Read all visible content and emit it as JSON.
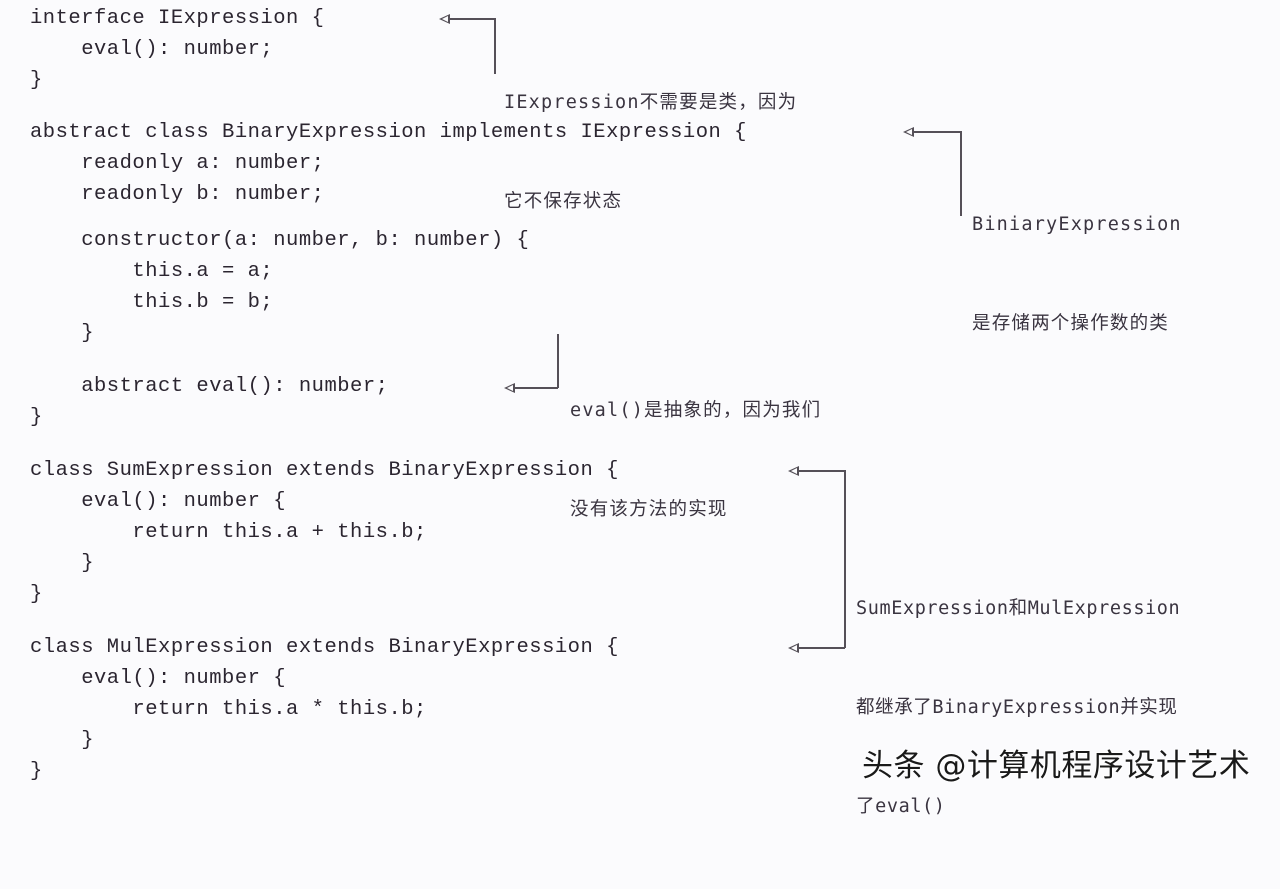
{
  "code": {
    "lines": [
      "interface IExpression {",
      "    eval(): number;",
      "}",
      "abstract class BinaryExpression implements IExpression {",
      "    readonly a: number;",
      "    readonly b: number;",
      "    constructor(a: number, b: number) {",
      "        this.a = a;",
      "        this.b = b;",
      "    }",
      "    abstract eval(): number;",
      "}",
      "class SumExpression extends BinaryExpression {",
      "    eval(): number {",
      "        return this.a + this.b;",
      "    }",
      "}",
      "class MulExpression extends BinaryExpression {",
      "    eval(): number {",
      "        return this.a * this.b;",
      "    }",
      "}"
    ]
  },
  "annotations": [
    {
      "target": "IExpression",
      "lines": [
        "IExpression不需要是类，因为",
        "它不保存状态"
      ]
    },
    {
      "target": "BinaryExpression",
      "lines": [
        "BiniaryExpression",
        "是存储两个操作数的类"
      ]
    },
    {
      "target": "abstract eval",
      "lines": [
        "eval()是抽象的，因为我们",
        "没有该方法的实现"
      ]
    },
    {
      "target": "SumExpression and MulExpression",
      "lines": [
        "SumExpression和MulExpression",
        "都继承了BinaryExpression并实现",
        "了eval()"
      ]
    }
  ],
  "watermark": {
    "text": "头条 @计算机程序设计艺术"
  }
}
